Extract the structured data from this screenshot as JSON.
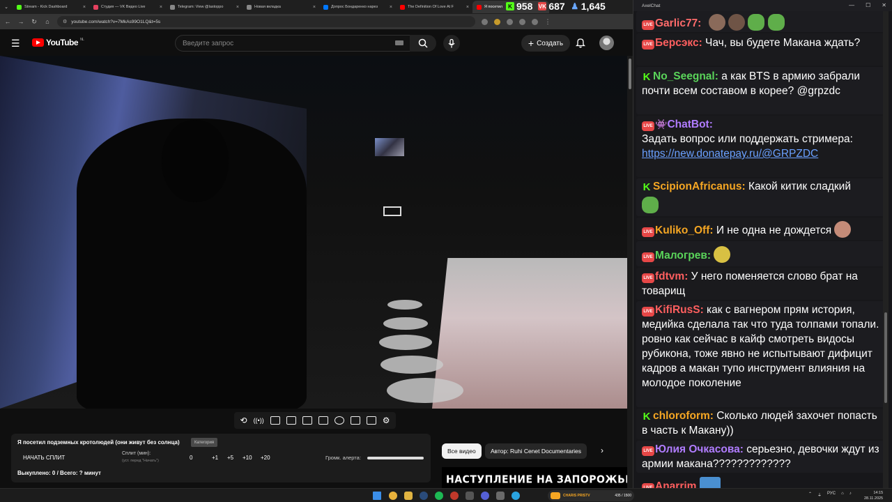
{
  "browser": {
    "tabs": [
      {
        "label": "Stream - Kick Dashboard",
        "color": "#53fc18"
      },
      {
        "label": "Студия — VK Видео Live",
        "color": "#e5415f"
      },
      {
        "label": "Telegram: View @lastoppo",
        "color": "#888888"
      },
      {
        "label": "Новая вкладка",
        "color": "#888888"
      },
      {
        "label": "Допрос Бондаренко нарез",
        "color": "#0077ff"
      },
      {
        "label": "The Definition Of Love At F",
        "color": "#ff0000"
      },
      {
        "label": "Я посетил",
        "color": "#ff0000"
      }
    ],
    "url": "youtube.com/watch?v=7MkAs99O1LQ&t=5s"
  },
  "overlay_counters": {
    "kick": "958",
    "vk": "687",
    "viewers": "1,645"
  },
  "youtube": {
    "logo_text": "YouTube",
    "region": "NL",
    "search_placeholder": "Введите запрос",
    "create_label": "Создать",
    "chips": {
      "all": "Все видео",
      "author": "Автор: Ruhi Cenet Documentaries"
    },
    "thumbnail_text": "НАСТУПЛЕНИЕ НА ЗАПОРОЖЬЕ"
  },
  "split_panel": {
    "title": "Я посетил подземных кротолюдей (они живут без солнца)",
    "category": "Категория",
    "start_label": "НАЧАТЬ СПЛИТ",
    "split_label": "Сплит (мин):",
    "split_sub": "(уст. перед \"Начать\")",
    "buttons": [
      "0",
      "+1",
      "+5",
      "+10",
      "+20"
    ],
    "volume_label": "Громк. алерта:",
    "bought": "Выкуплено: 0 / Всего: ? минут"
  },
  "chat": {
    "window_title": "AxelChat",
    "messages": [
      {
        "platform": "live",
        "user": "Garlic77:",
        "color": "#ff6b6b",
        "text": ""
      },
      {
        "platform": "live",
        "user": "Берсэкс:",
        "color": "#ff5f5f",
        "text": " Чач, вы будете Макана ждать?"
      },
      {
        "platform": "kick",
        "user": "No_Seegnal:",
        "color": "#5ad45a",
        "text": " а как BTS в армию забрали почти всем составом в корее? @grpzdc"
      },
      {
        "platform": "live",
        "user": "ChatBot:",
        "color": "#b07cff",
        "text": "Задать вопрос или поддержать стримера:",
        "link": "https://new.donatepay.ru/@GRPZDC"
      },
      {
        "platform": "kick",
        "user": "ScipionAfricanus:",
        "color": "#f5a623",
        "text": " Какой китик сладкий"
      },
      {
        "platform": "live",
        "user": "Kuliko_Off:",
        "color": "#f5a623",
        "text": " И не одна не дождется"
      },
      {
        "platform": "live",
        "user": "Малогрев:",
        "color": "#5ad45a",
        "text": ""
      },
      {
        "platform": "live",
        "user": "fdtvm:",
        "color": "#ff5f5f",
        "text": " У него поменяется слово брат на товарищ"
      },
      {
        "platform": "live",
        "user": "KifiRusS:",
        "color": "#ff5f5f",
        "text": " как с вагнером прям история, медийка сделала так что туда толпами топали. ровно как сейчас в кайф смотреть видосы рубикона, тоже явно не испытывают дифицит кадров а макан тупо инструмент влияния на молодое поколение"
      },
      {
        "platform": "kick",
        "user": "chloroform:",
        "color": "#f5a623",
        "text": " Сколько людей захочет попасть в часть к Макану))"
      },
      {
        "platform": "live",
        "user": "Юлия Очкасова:",
        "color": "#b07cff",
        "text": " серьезно, девочки ждут из армии макана?????????????"
      },
      {
        "platform": "live",
        "user": "Anarrim",
        "color": "#ff5f5f",
        "text": ""
      }
    ]
  },
  "taskbar": {
    "overlay_text": "CHARIS PRISTV",
    "overlay_count": "435 / 1500",
    "lang": "РУС",
    "time": "14:15",
    "date": "28.11.2025"
  }
}
